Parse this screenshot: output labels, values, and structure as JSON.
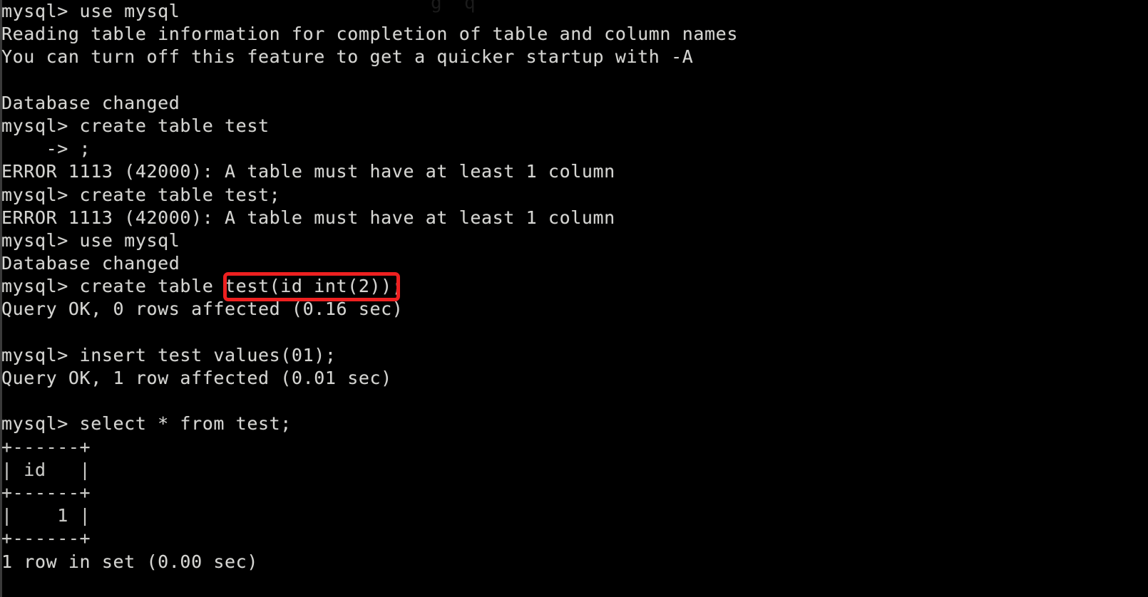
{
  "terminal": {
    "app": "mysql-client-console",
    "background_color": "#000000",
    "text_color": "#d5d5d2",
    "clipped_top_text": "g  q",
    "lines": [
      "mysql> use mysql",
      "Reading table information for completion of table and column names",
      "You can turn off this feature to get a quicker startup with -A",
      "",
      "Database changed",
      "mysql> create table test",
      "    -> ;",
      "ERROR 1113 (42000): A table must have at least 1 column",
      "mysql> create table test;",
      "ERROR 1113 (42000): A table must have at least 1 column",
      "mysql> use mysql",
      "Database changed",
      "mysql> create table test(id int(2));",
      "Query OK, 0 rows affected (0.16 sec)",
      "",
      "mysql> insert test values(01);",
      "Query OK, 1 row affected (0.01 sec)",
      "",
      "mysql> select * from test;",
      "+------+",
      "| id   |",
      "+------+",
      "|    1 |",
      "+------+",
      "1 row in set (0.00 sec)"
    ]
  },
  "annotation": {
    "type": "rectangle-highlight",
    "color": "#ee2020",
    "highlighted_text": "test(id int(2));",
    "target_line": "mysql> create table test(id int(2));"
  }
}
